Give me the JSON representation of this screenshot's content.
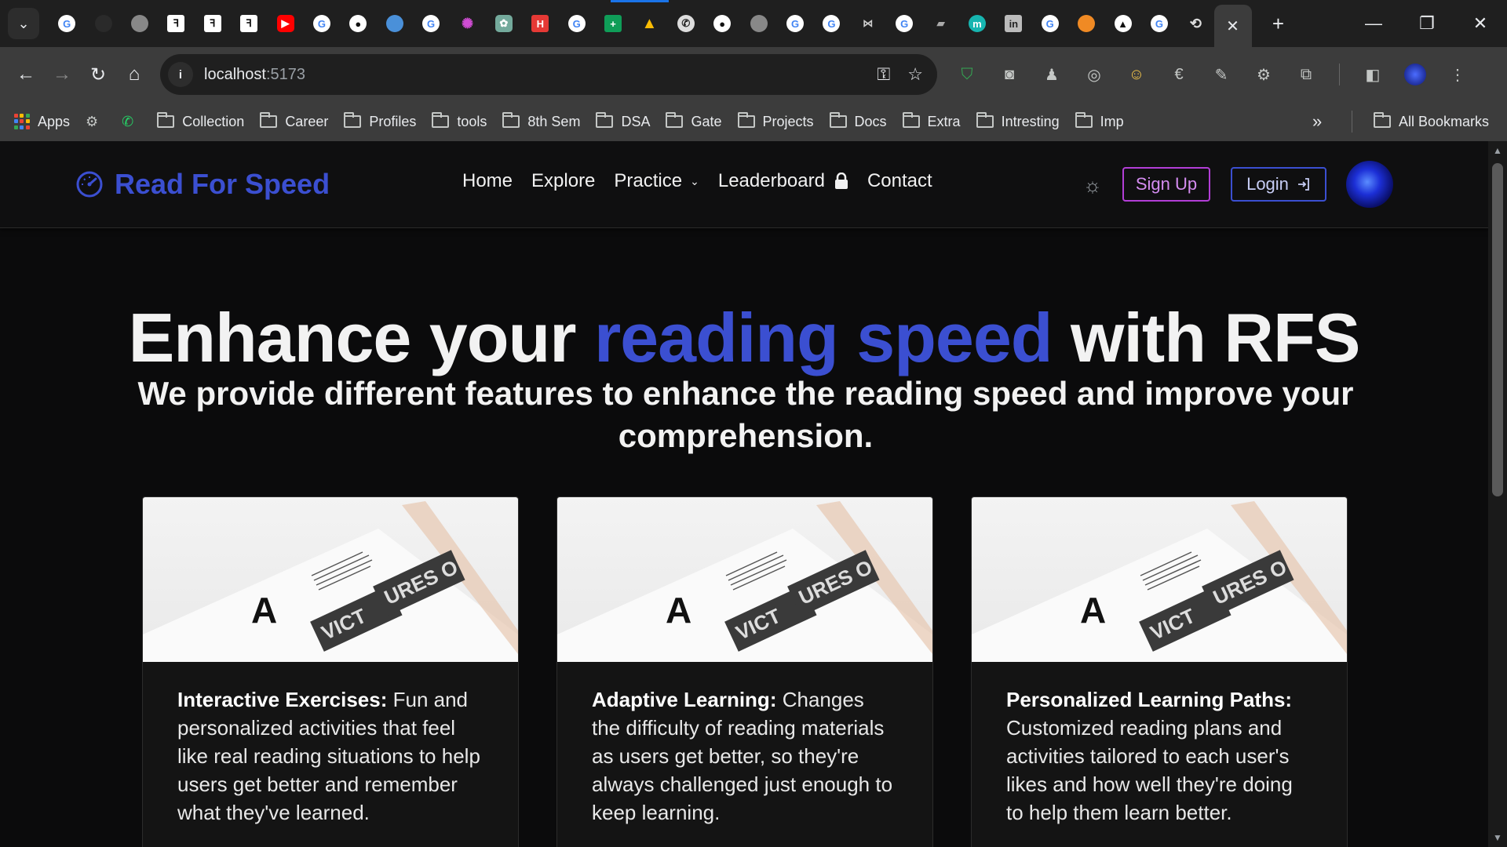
{
  "browser": {
    "tab_count": 33,
    "omnibox": {
      "host": "localhost",
      "port": ":5173"
    },
    "window_controls": {
      "minimize": "—",
      "restore": "❐",
      "close": "✕"
    },
    "bookmarks": {
      "apps_label": "Apps",
      "items": [
        "Collection",
        "Career",
        "Profiles",
        "tools",
        "8th Sem",
        "DSA",
        "Gate",
        "Projects",
        "Docs",
        "Extra",
        "Intresting",
        "Imp"
      ],
      "all_bookmarks": "All Bookmarks"
    }
  },
  "site": {
    "brand": "Read For Speed",
    "nav": {
      "home": "Home",
      "explore": "Explore",
      "practice": "Practice",
      "leaderboard": "Leaderboard",
      "contact": "Contact"
    },
    "signup": "Sign Up",
    "login": "Login",
    "colors": {
      "accent": "#3b4fd1",
      "signup_border": "#b23ed6"
    }
  },
  "hero": {
    "title_pre": "Enhance your ",
    "title_accent": "reading speed",
    "title_post": " with RFS",
    "subtitle": "We provide different features to enhance the reading speed and improve your comprehension."
  },
  "cards": [
    {
      "title": "Interactive Exercises:",
      "text": " Fun and personalized activities that feel like real reading situations to help users get better and remember what they've learned."
    },
    {
      "title": "Adaptive Learning:",
      "text": " Changes the difficulty of reading materials as users get better, so they're always challenged just enough to keep learning."
    },
    {
      "title": "Personalized Learning Paths:",
      "text": " Customized reading plans and activities tailored to each user's likes and how well they're doing to help them learn better."
    }
  ],
  "card_image": {
    "letter": "A",
    "label_1": "VICT",
    "label_2": "URES O"
  }
}
